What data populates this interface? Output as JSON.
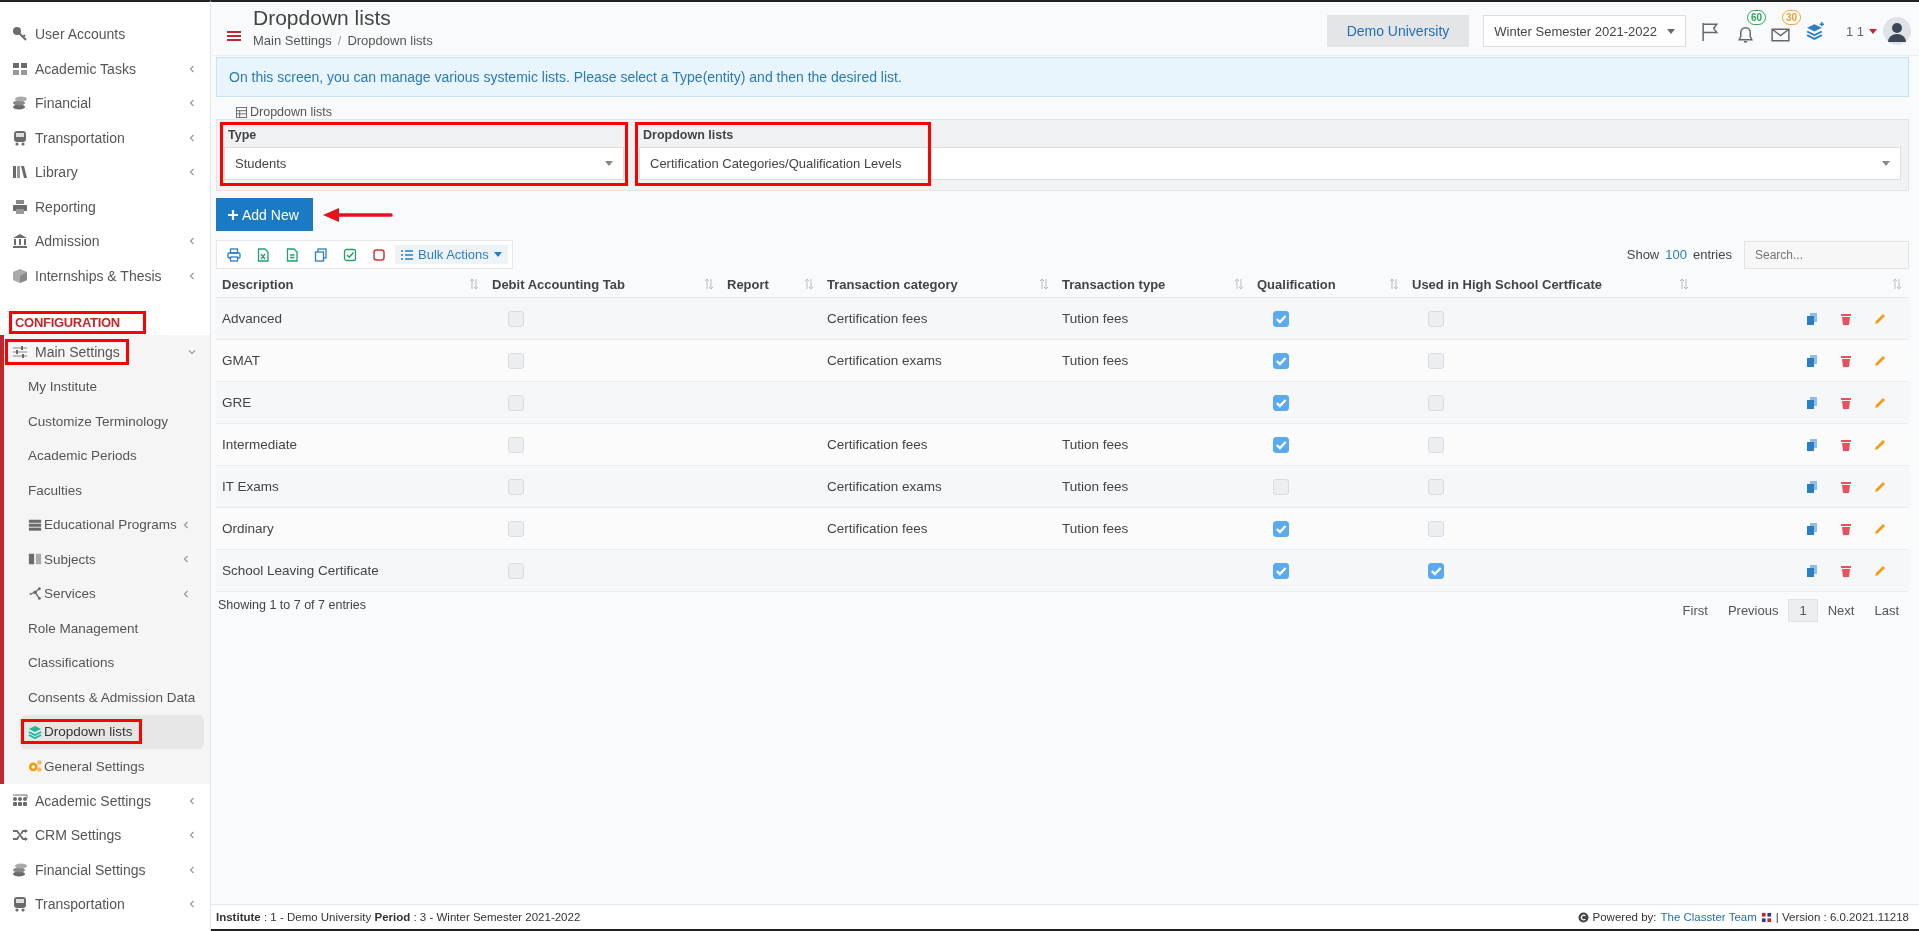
{
  "sidebar": {
    "items": [
      {
        "kind": "item",
        "label": "User Accounts",
        "selected": false
      },
      {
        "kind": "item",
        "label": "Academic Tasks",
        "has_submenu": true,
        "selected": false
      },
      {
        "kind": "item",
        "label": "Financial",
        "has_submenu": true,
        "selected": false
      },
      {
        "kind": "item",
        "label": "Transportation",
        "has_submenu": true,
        "selected": false
      },
      {
        "kind": "item",
        "label": "Library",
        "has_submenu": true,
        "selected": false
      },
      {
        "kind": "item",
        "label": "Reporting",
        "selected": false
      },
      {
        "kind": "item",
        "label": "Admission",
        "has_submenu": true,
        "selected": false
      },
      {
        "kind": "item",
        "label": "Internships & Thesis",
        "has_submenu": true,
        "selected": false
      },
      {
        "kind": "section",
        "label": "CONFIGURATION",
        "annotated": true
      },
      {
        "kind": "group",
        "label": "Main Settings",
        "has_submenu": true,
        "expanded": true,
        "annotated": true,
        "selected": false,
        "children": [
          {
            "label": "My Institute",
            "selected": false
          },
          {
            "label": "Customize Terminology",
            "selected": false
          },
          {
            "label": "Academic Periods",
            "selected": false
          },
          {
            "label": "Faculties",
            "selected": false
          },
          {
            "label": "Educational Programs",
            "has_submenu": true,
            "selected": false
          },
          {
            "label": "Subjects",
            "has_submenu": true,
            "selected": false
          },
          {
            "label": "Services",
            "has_submenu": true,
            "selected": false
          },
          {
            "label": "Role Management",
            "selected": false
          },
          {
            "label": "Classifications",
            "selected": false
          },
          {
            "label": "Consents & Admission Data",
            "selected": false
          },
          {
            "label": "Dropdown lists",
            "selected": true,
            "annotated": true
          },
          {
            "label": "General Settings",
            "selected": false
          }
        ]
      },
      {
        "kind": "item",
        "label": "Academic Settings",
        "has_submenu": true,
        "selected": false
      },
      {
        "kind": "item",
        "label": "CRM Settings",
        "has_submenu": true,
        "selected": false
      },
      {
        "kind": "item",
        "label": "Financial Settings",
        "has_submenu": true,
        "selected": false
      },
      {
        "kind": "item",
        "label": "Transportation",
        "has_submenu": true,
        "selected": false
      }
    ]
  },
  "header": {
    "title": "Dropdown lists",
    "breadcrumb": [
      "Main Settings",
      "Dropdown lists"
    ],
    "breadcrumb_separator": "/",
    "institute_button": "Demo University",
    "period_select": "Winter Semester 2021-2022",
    "notifications": [
      {
        "count": "60",
        "color": "#27a35a"
      },
      {
        "count": "30",
        "color": "#f0a030"
      }
    ],
    "user": "1 1"
  },
  "info": "On this screen, you can manage various systemic lists. Please select a Type(entity) and then the desired list.",
  "panel": {
    "legend": "Dropdown lists",
    "type": {
      "label": "Type",
      "value": "Students",
      "annotated": true
    },
    "list": {
      "label": "Dropdown lists",
      "value": "Certification Categories/Qualification Levels",
      "annotated": true
    }
  },
  "add_button": {
    "label": "Add New",
    "pointer_arrow": true
  },
  "toolbar": {
    "bulk_actions": "Bulk Actions"
  },
  "length": {
    "before": "Show",
    "value": "100",
    "after": "entries"
  },
  "search": {
    "placeholder": "Search..."
  },
  "table": {
    "columns": [
      "Description",
      "Debit Accounting Tab",
      "Report",
      "Transaction category",
      "Transaction type",
      "Qualification",
      "Used in High School Certficate"
    ],
    "rows": [
      {
        "description": "Advanced",
        "debit_accounting_tab": false,
        "transaction_category": "Certification fees",
        "transaction_type": "Tution fees",
        "qualification": true,
        "used_in_high_school": false
      },
      {
        "description": "GMAT",
        "debit_accounting_tab": false,
        "transaction_category": "Certification exams",
        "transaction_type": "Tution fees",
        "qualification": true,
        "used_in_high_school": false
      },
      {
        "description": "GRE",
        "debit_accounting_tab": false,
        "qualification": true,
        "used_in_high_school": false
      },
      {
        "description": "Intermediate",
        "debit_accounting_tab": false,
        "transaction_category": "Certification fees",
        "transaction_type": "Tution fees",
        "qualification": true,
        "used_in_high_school": false
      },
      {
        "description": "IT Exams",
        "debit_accounting_tab": false,
        "transaction_category": "Certification exams",
        "transaction_type": "Tution fees",
        "qualification": false,
        "used_in_high_school": false
      },
      {
        "description": "Ordinary",
        "debit_accounting_tab": false,
        "transaction_category": "Certification fees",
        "transaction_type": "Tution fees",
        "qualification": true,
        "used_in_high_school": false
      },
      {
        "description": "School Leaving Certificate",
        "debit_accounting_tab": false,
        "qualification": true,
        "used_in_high_school": true
      }
    ]
  },
  "table_info": "Showing 1 to 7 of 7 entries",
  "pagination": [
    {
      "label": "First",
      "selected": false
    },
    {
      "label": "Previous",
      "selected": false
    },
    {
      "label": "1",
      "selected": true
    },
    {
      "label": "Next",
      "selected": false
    },
    {
      "label": "Last",
      "selected": false
    }
  ],
  "footer": {
    "left": "**Institute** : 1 - Demo University **Period** : 3 - Winter Semester 2021-2022",
    "powered": "Powered by:",
    "link": "The Classter Team",
    "version": "| Version : 6.0.2021.11218"
  }
}
